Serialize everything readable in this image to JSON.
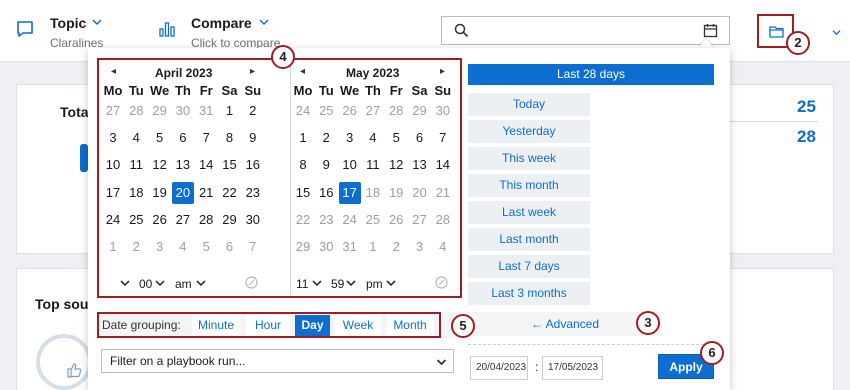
{
  "topbar": {
    "topic_title": "Topic",
    "topic_sub": "Claralines",
    "compare_title": "Compare",
    "compare_sub": "Click to compare"
  },
  "cards": {
    "total_label": "Tota",
    "top_label": "Top sou",
    "num_1": "25",
    "num_2": "28"
  },
  "calendar": {
    "dow": [
      "Mo",
      "Tu",
      "We",
      "Th",
      "Fr",
      "Sa",
      "Su"
    ],
    "left": {
      "title": "April 2023",
      "weeks": [
        [
          "27",
          "28",
          "29",
          "30",
          "31",
          "1",
          "2"
        ],
        [
          "3",
          "4",
          "5",
          "6",
          "7",
          "8",
          "9"
        ],
        [
          "10",
          "11",
          "12",
          "13",
          "14",
          "15",
          "16"
        ],
        [
          "17",
          "18",
          "19",
          "20",
          "21",
          "22",
          "23"
        ],
        [
          "24",
          "25",
          "26",
          "27",
          "28",
          "29",
          "30"
        ],
        [
          "1",
          "2",
          "3",
          "4",
          "5",
          "6",
          "7"
        ]
      ],
      "hour": "00",
      "ampm": "am"
    },
    "right": {
      "title": "May 2023",
      "weeks": [
        [
          "24",
          "25",
          "26",
          "27",
          "28",
          "29",
          "30"
        ],
        [
          "1",
          "2",
          "3",
          "4",
          "5",
          "6",
          "7"
        ],
        [
          "8",
          "9",
          "10",
          "11",
          "12",
          "13",
          "14"
        ],
        [
          "15",
          "16",
          "17",
          "18",
          "19",
          "20",
          "21"
        ],
        [
          "22",
          "23",
          "24",
          "25",
          "26",
          "27",
          "28"
        ],
        [
          "29",
          "30",
          "31",
          "1",
          "2",
          "3",
          "4"
        ]
      ],
      "hour": "11",
      "minute": "59",
      "ampm": "pm"
    }
  },
  "presets": {
    "active": "Last 28 days",
    "items": [
      "Today",
      "Yesterday",
      "This week",
      "This month",
      "Last week",
      "Last month",
      "Last 7 days",
      "Last 3 months"
    ]
  },
  "grouping": {
    "label": "Date grouping:",
    "options": [
      "Minute",
      "Hour",
      "Day",
      "Week",
      "Month"
    ],
    "selected": "Day"
  },
  "advanced_label": "← Advanced",
  "filter_select": "Filter on a playbook run...",
  "date_from": "20/04/2023",
  "date_to": "17/05/2023",
  "colon": ":",
  "apply_label": "Apply",
  "callouts": [
    "2",
    "3",
    "4",
    "5",
    "6"
  ],
  "colors": {
    "accent": "#0b6ed0",
    "callout_border": "#a11d22"
  }
}
